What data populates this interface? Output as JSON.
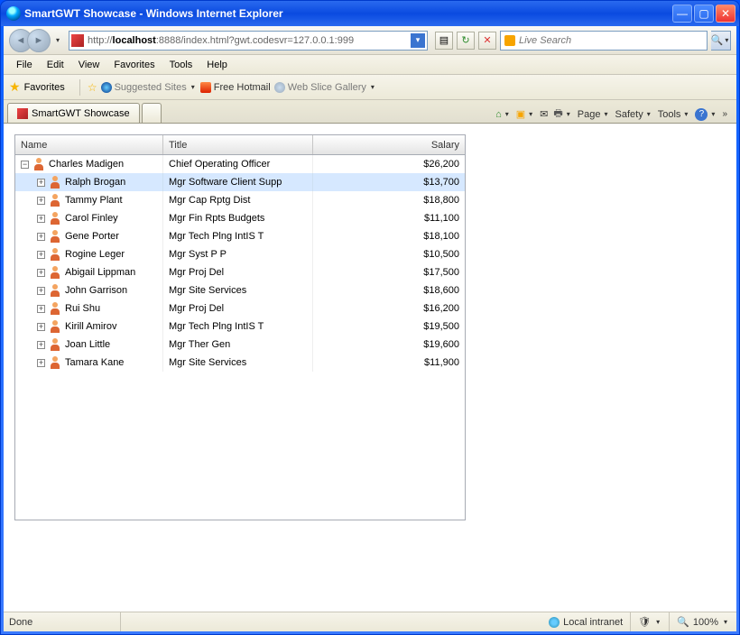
{
  "window": {
    "title": "SmartGWT Showcase - Windows Internet Explorer"
  },
  "address": {
    "prefix": "http://",
    "host": "localhost",
    "rest": ":8888/index.html?gwt.codesvr=127.0.0.1:999"
  },
  "search": {
    "placeholder": "Live Search"
  },
  "menu": {
    "file": "File",
    "edit": "Edit",
    "view": "View",
    "favorites": "Favorites",
    "tools": "Tools",
    "help": "Help"
  },
  "favbar": {
    "label": "Favorites",
    "suggested": "Suggested Sites",
    "hotmail": "Free Hotmail",
    "webslice": "Web Slice Gallery"
  },
  "tab": {
    "label": "SmartGWT Showcase"
  },
  "cmd": {
    "page": "Page",
    "safety": "Safety",
    "tools": "Tools"
  },
  "grid": {
    "headers": {
      "name": "Name",
      "title": "Title",
      "salary": "Salary"
    },
    "root": {
      "name": "Charles Madigen",
      "title": "Chief Operating Officer",
      "salary": "$26,200",
      "expanded": true
    },
    "rows": [
      {
        "name": "Ralph Brogan",
        "title": "Mgr Software Client Supp",
        "salary": "$13,700",
        "selected": true
      },
      {
        "name": "Tammy Plant",
        "title": "Mgr Cap Rptg Dist",
        "salary": "$18,800"
      },
      {
        "name": "Carol Finley",
        "title": "Mgr Fin Rpts Budgets",
        "salary": "$11,100"
      },
      {
        "name": "Gene Porter",
        "title": "Mgr Tech Plng IntIS T",
        "salary": "$18,100"
      },
      {
        "name": "Rogine Leger",
        "title": "Mgr Syst P P",
        "salary": "$10,500"
      },
      {
        "name": "Abigail Lippman",
        "title": "Mgr Proj Del",
        "salary": "$17,500"
      },
      {
        "name": "John Garrison",
        "title": "Mgr Site Services",
        "salary": "$18,600"
      },
      {
        "name": "Rui Shu",
        "title": "Mgr Proj Del",
        "salary": "$16,200"
      },
      {
        "name": "Kirill Amirov",
        "title": "Mgr Tech Plng IntIS T",
        "salary": "$19,500"
      },
      {
        "name": "Joan Little",
        "title": "Mgr Ther Gen",
        "salary": "$19,600"
      },
      {
        "name": "Tamara Kane",
        "title": "Mgr Site Services",
        "salary": "$11,900"
      }
    ]
  },
  "status": {
    "left": "Done",
    "zone": "Local intranet",
    "zoom": "100%"
  }
}
